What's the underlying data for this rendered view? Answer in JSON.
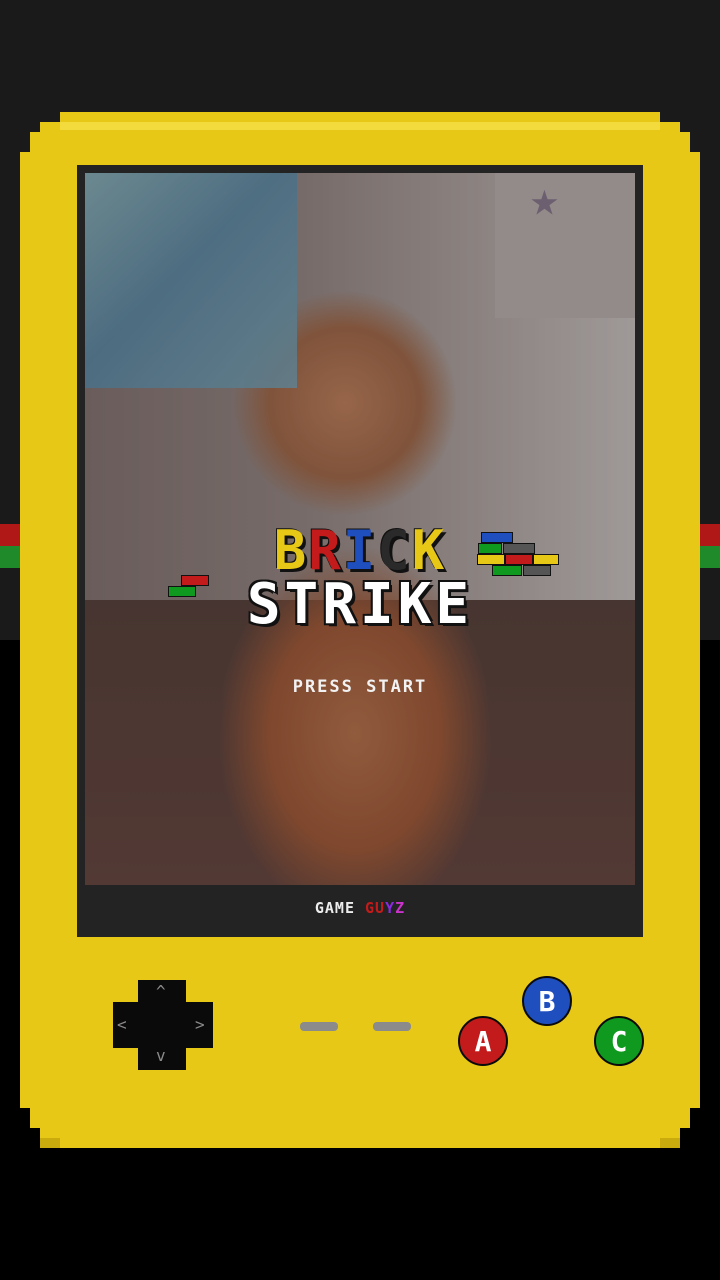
{
  "colors": {
    "console_body": "#e8c817",
    "stripe_red": "#b01818",
    "stripe_green": "#1e8a2a",
    "button_a": "#c31b1b",
    "button_b": "#1f4fbf",
    "button_c": "#0f9a1f",
    "title_letters": [
      "#e8c817",
      "#e8c817",
      "#c31b1b",
      "#1f4fbf",
      "#222222",
      "#e8c817"
    ]
  },
  "title": {
    "line1_letters": [
      "B",
      "R",
      "I",
      "C",
      "K"
    ],
    "line2": "STRIKE"
  },
  "prompt": "PRESS START",
  "brand": {
    "word1": "GAME",
    "word2_letters": [
      "G",
      "U",
      "Y",
      "Z"
    ],
    "word2_colors": [
      "#c31b1b",
      "#c31b1b",
      "#8a2be2",
      "#cc33cc"
    ]
  },
  "controls": {
    "dpad": {
      "up": "^",
      "down": "v",
      "left": "<",
      "right": ">"
    },
    "button_a": "A",
    "button_b": "B",
    "button_c": "C"
  },
  "icons": {
    "dpad": "dpad-icon",
    "select": "select-button",
    "start": "start-button"
  }
}
